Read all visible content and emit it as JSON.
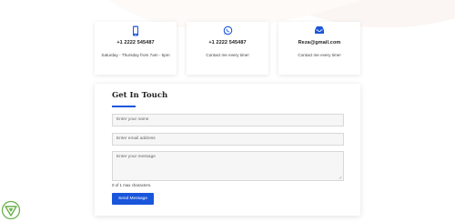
{
  "contact_cards": [
    {
      "icon": "phone-icon",
      "main": "+1 2222 545487",
      "sub": "Saturday - Thursday from 7am - 5pm"
    },
    {
      "icon": "whatsapp-icon",
      "main": "+1 2222 545487",
      "sub": "Contact me every time!"
    },
    {
      "icon": "mail-inbox-icon",
      "main": "Reza@gmail.com",
      "sub": "Contact me every time!"
    }
  ],
  "form": {
    "title": "Get In Touch",
    "name_placeholder": "Enter your name",
    "email_placeholder": "Enter email address",
    "message_placeholder": "Enter your message",
    "char_counter": "0 of 1 max characters.",
    "submit_label": "Send Message"
  },
  "colors": {
    "accent": "#1a56db",
    "logo": "#6ab04c"
  }
}
